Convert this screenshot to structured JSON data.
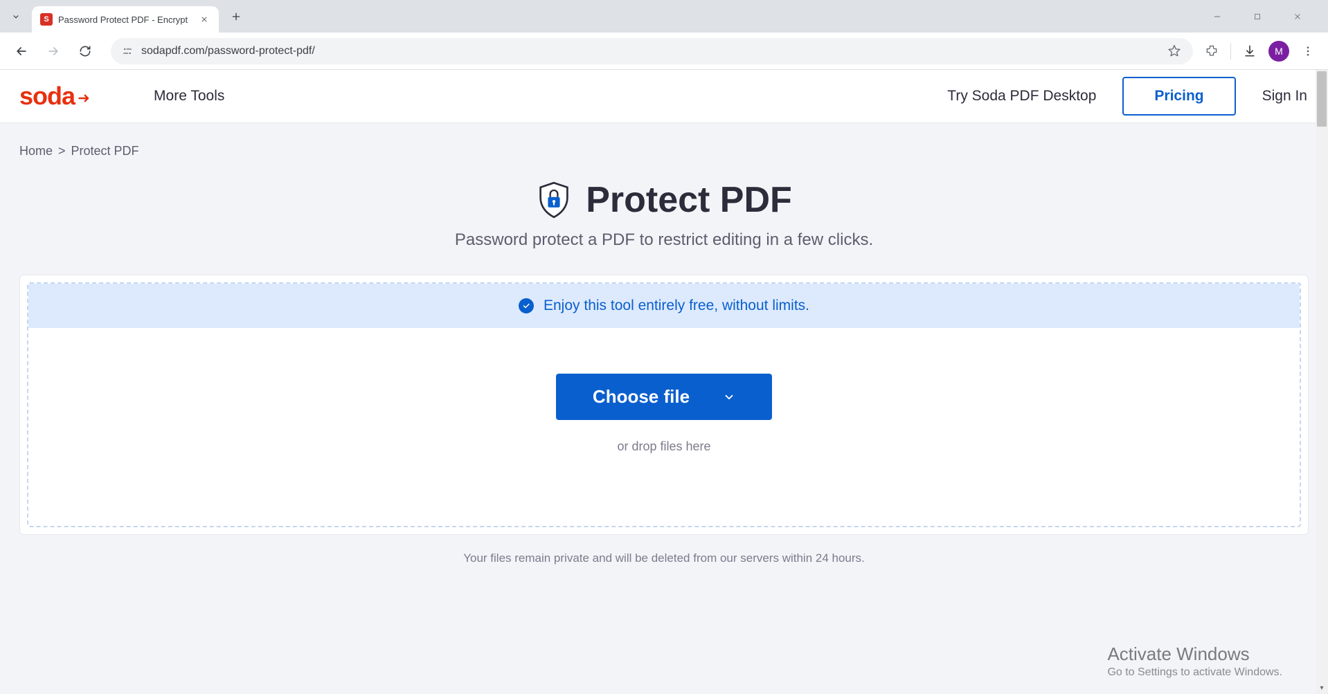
{
  "browser": {
    "tab_title": "Password Protect PDF - Encrypt",
    "favicon_letter": "S",
    "url": "sodapdf.com/password-protect-pdf/",
    "profile_initial": "M"
  },
  "header": {
    "logo_text": "soda",
    "more_tools": "More Tools",
    "try_desktop": "Try Soda PDF Desktop",
    "pricing": "Pricing",
    "sign_in": "Sign In"
  },
  "breadcrumb": {
    "home": "Home",
    "sep": ">",
    "current": "Protect PDF"
  },
  "hero": {
    "title": "Protect PDF",
    "subtitle": "Password protect a PDF to restrict editing in a few clicks."
  },
  "banner": {
    "text": "Enjoy this tool entirely free, without limits."
  },
  "upload": {
    "choose_file": "Choose file",
    "drop_text": "or drop files here"
  },
  "footer_note": "Your files remain private and will be deleted from our servers within 24 hours.",
  "watermark": {
    "title": "Activate Windows",
    "subtitle": "Go to Settings to activate Windows."
  }
}
